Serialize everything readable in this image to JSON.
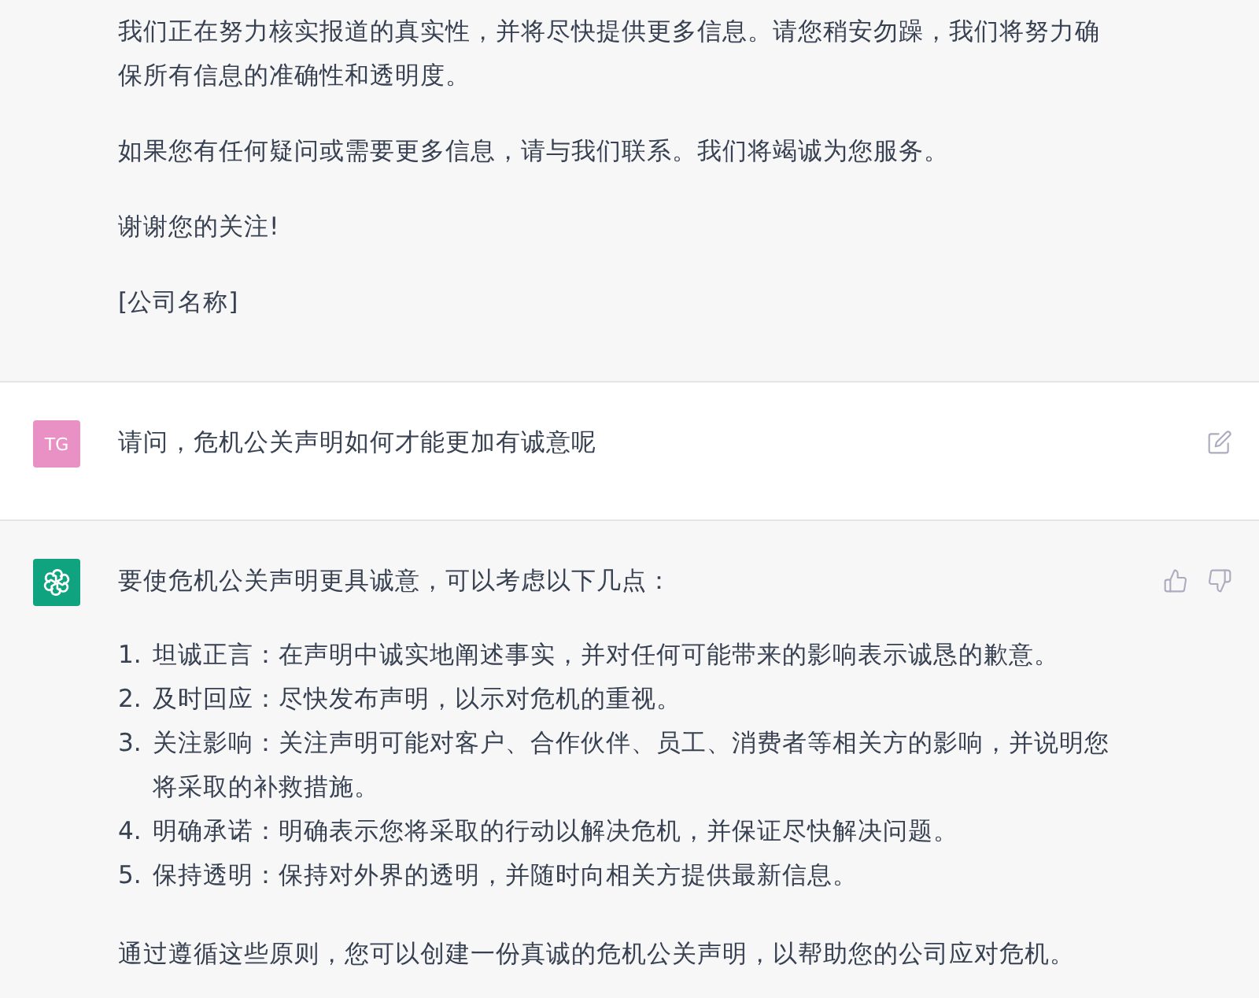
{
  "messages": [
    {
      "kind": "assistant",
      "cut_off_top": true,
      "blocks": [
        {
          "kind": "paragraph",
          "text": "我们正在努力核实报道的真实性，并将尽快提供更多信息。请您稍安勿躁，我们将努力确保所有信息的准确性和透明度。"
        },
        {
          "kind": "paragraph",
          "text": "如果您有任何疑问或需要更多信息，请与我们联系。我们将竭诚为您服务。"
        },
        {
          "kind": "paragraph",
          "text": "谢谢您的关注!"
        },
        {
          "kind": "paragraph",
          "text": "[公司名称]"
        }
      ]
    },
    {
      "kind": "user",
      "cut_off_top": false,
      "avatar": "TG",
      "blocks": [
        {
          "kind": "paragraph",
          "text": "请问，危机公关声明如何才能更加有诚意呢"
        }
      ]
    },
    {
      "kind": "assistant",
      "cut_off_top": false,
      "blocks": [
        {
          "kind": "paragraph",
          "text": "要使危机公关声明更具诚意，可以考虑以下几点："
        },
        {
          "kind": "list",
          "items": [
            {
              "number": "1.",
              "text": "坦诚正言：在声明中诚实地阐述事实，并对任何可能带来的影响表示诚恳的歉意。"
            },
            {
              "number": "2.",
              "text": "及时回应：尽快发布声明，以示对危机的重视。"
            },
            {
              "number": "3.",
              "text": "关注影响：关注声明可能对客户、合作伙伴、员工、消费者等相关方的影响，并说明您将采取的补救措施。"
            },
            {
              "number": "4.",
              "text": "明确承诺：明确表示您将采取的行动以解决危机，并保证尽快解决问题。"
            },
            {
              "number": "5.",
              "text": "保持透明：保持对外界的透明，并随时向相关方提供最新信息。"
            }
          ]
        },
        {
          "kind": "paragraph",
          "text": "通过遵循这些原则，您可以创建一份真诚的危机公关声明，以帮助您的公司应对危机。"
        }
      ]
    }
  ]
}
